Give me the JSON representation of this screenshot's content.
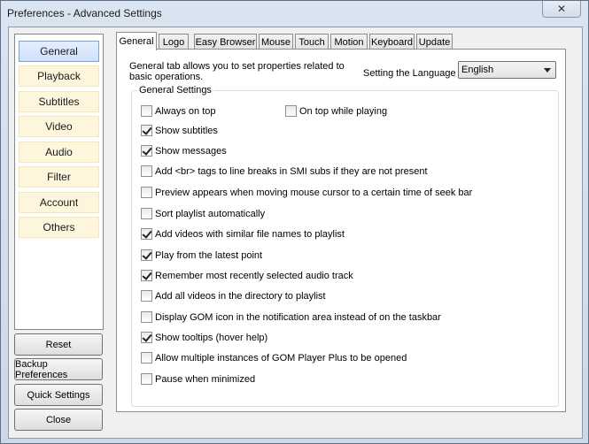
{
  "window": {
    "title": "Preferences - Advanced Settings",
    "close_glyph": "✕"
  },
  "nav": {
    "items": [
      {
        "label": "General",
        "active": true
      },
      {
        "label": "Playback",
        "active": false
      },
      {
        "label": "Subtitles",
        "active": false
      },
      {
        "label": "Video",
        "active": false
      },
      {
        "label": "Audio",
        "active": false
      },
      {
        "label": "Filter",
        "active": false
      },
      {
        "label": "Account",
        "active": false
      },
      {
        "label": "Others",
        "active": false
      }
    ]
  },
  "buttons": {
    "reset": "Reset",
    "backup": "Backup Preferences",
    "quick": "Quick Settings",
    "close": "Close"
  },
  "tabs": [
    {
      "label": "General",
      "active": true
    },
    {
      "label": "Logo",
      "active": false
    },
    {
      "label": "Easy Browser",
      "active": false
    },
    {
      "label": "Mouse",
      "active": false
    },
    {
      "label": "Touch",
      "active": false
    },
    {
      "label": "Motion",
      "active": false
    },
    {
      "label": "Keyboard",
      "active": false
    },
    {
      "label": "Update",
      "active": false
    }
  ],
  "general": {
    "description": "General tab allows you to set properties related to basic operations.",
    "language_label": "Setting the Language",
    "language_value": "English",
    "group_title": "General Settings",
    "options": [
      {
        "label": "Always on top",
        "checked": false
      },
      {
        "label": "On top while playing",
        "checked": false
      },
      {
        "label": "Show subtitles",
        "checked": true
      },
      {
        "label": "Show messages",
        "checked": true
      },
      {
        "label": "Add <br> tags to line breaks in SMI subs if they are not present",
        "checked": false
      },
      {
        "label": "Preview appears when moving mouse cursor to a certain time of seek bar",
        "checked": false
      },
      {
        "label": "Sort playlist automatically",
        "checked": false
      },
      {
        "label": "Add videos with similar file names to playlist",
        "checked": true
      },
      {
        "label": "Play from the latest point",
        "checked": true
      },
      {
        "label": "Remember most recently selected audio track",
        "checked": true
      },
      {
        "label": "Add all videos in the directory to playlist",
        "checked": false
      },
      {
        "label": "Display GOM icon in the notification area instead of on the taskbar",
        "checked": false
      },
      {
        "label": "Show tooltips (hover help)",
        "checked": true
      },
      {
        "label": "Allow multiple instances of GOM Player Plus to be opened",
        "checked": false
      },
      {
        "label": "Pause when minimized",
        "checked": false
      }
    ]
  }
}
